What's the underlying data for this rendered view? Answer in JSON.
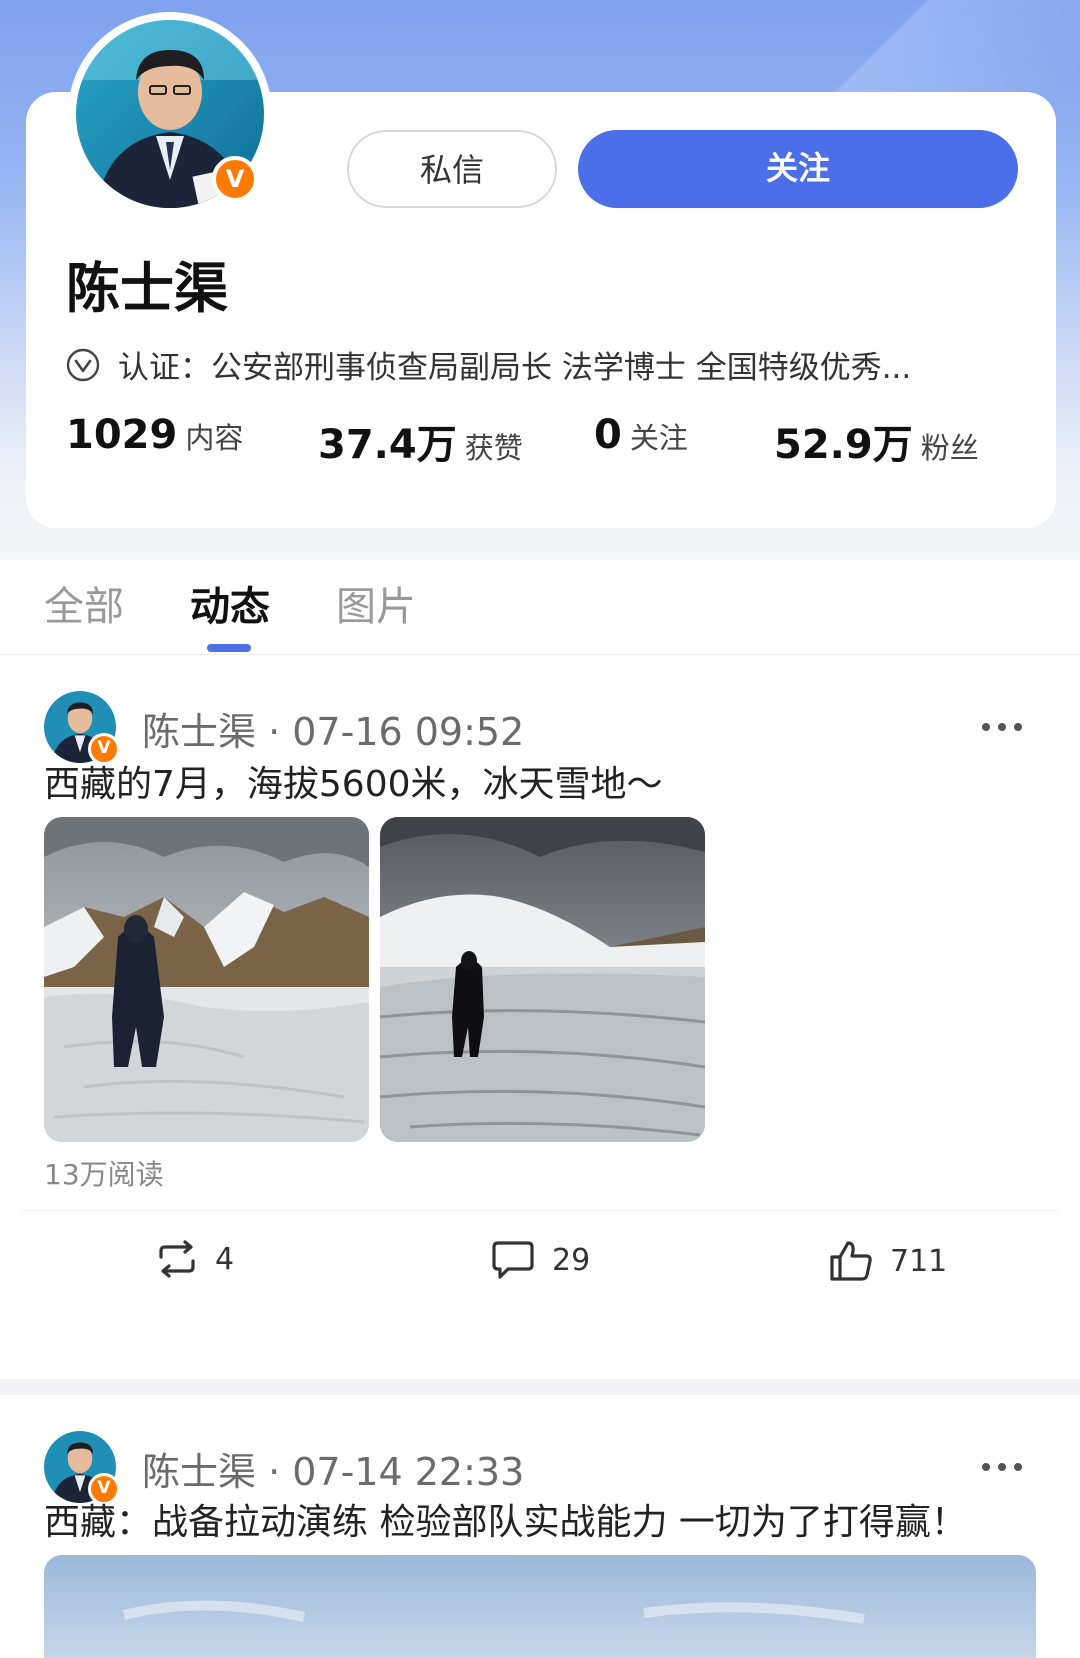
{
  "profile": {
    "name": "陈士渠",
    "verified_badge": "V",
    "message_button": "私信",
    "follow_button": "关注",
    "verification": "认证：公安部刑事侦查局副局长 法学博士 全国特级优秀...",
    "stats": [
      {
        "value": "1029",
        "label": "内容"
      },
      {
        "value": "37.4万",
        "label": "获赞"
      },
      {
        "value": "0",
        "label": "关注"
      },
      {
        "value": "52.9万",
        "label": "粉丝"
      }
    ],
    "accent_color": "#4a6fe8",
    "badge_color": "#ff7a00"
  },
  "tabs": [
    {
      "label": "全部",
      "active": false
    },
    {
      "label": "动态",
      "active": true
    },
    {
      "label": "图片",
      "active": false
    }
  ],
  "posts": [
    {
      "author": "陈士渠",
      "meta": "陈士渠 · 07-16 09:52",
      "text": "西藏的7月，海拔5600米，冰天雪地～",
      "read_count": "13万阅读",
      "reposts": "4",
      "comments": "29",
      "likes": "711"
    },
    {
      "author": "陈士渠",
      "meta": "陈士渠 · 07-14 22:33",
      "text": "西藏：战备拉动演练 检验部队实战能力 一切为了打得赢！"
    }
  ]
}
